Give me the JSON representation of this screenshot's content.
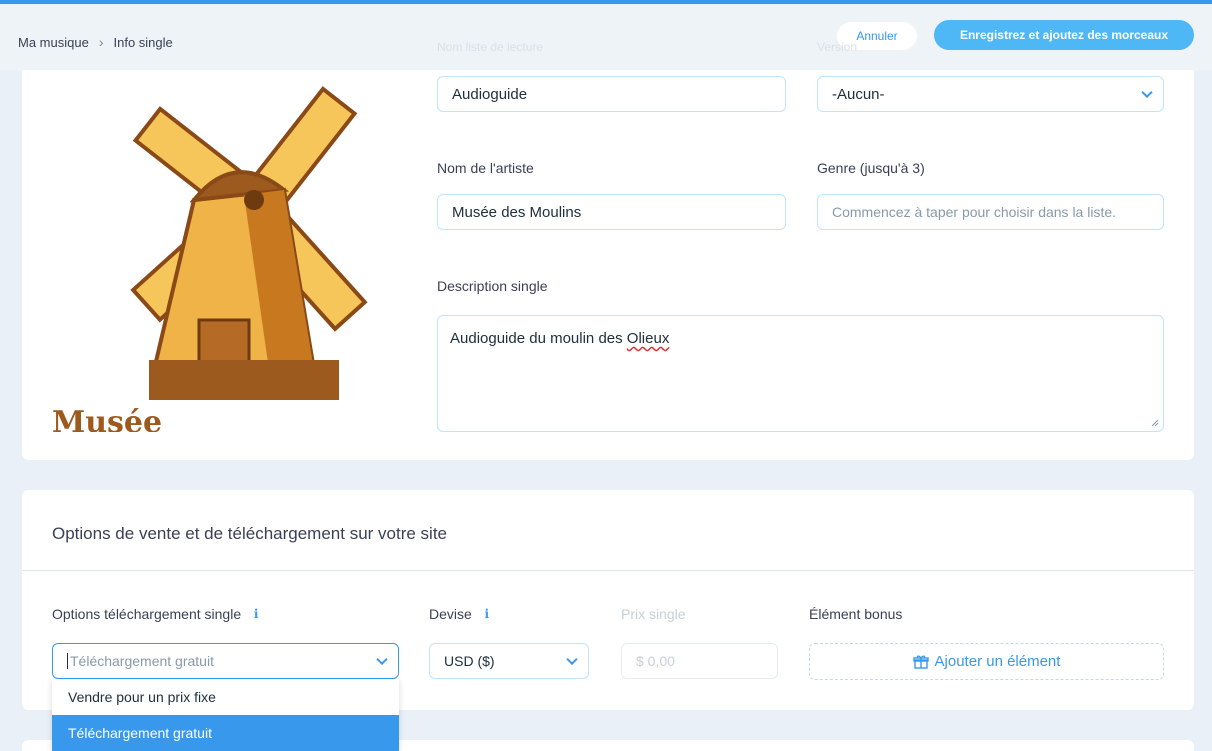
{
  "header": {
    "breadcrumb": [
      "Ma musique",
      "Info single"
    ],
    "cancel_label": "Annuler",
    "save_label": "Enregistrez et ajoutez des morceaux"
  },
  "form": {
    "playlist_name_label": "Nom liste de lecture",
    "playlist_name_value": "Audioguide",
    "version_label": "Version",
    "version_value": "-Aucun-",
    "artist_label": "Nom de l'artiste",
    "artist_value": "Musée des Moulins",
    "genre_label": "Genre (jusqu'à 3)",
    "genre_placeholder": "Commencez à taper pour choisir dans la liste.",
    "description_label": "Description single",
    "description_value_prefix": "Audioguide du moulin des ",
    "description_value_misspelled": "Olieux",
    "cover_caption": "Musée"
  },
  "sales": {
    "title": "Options de vente et de téléchargement sur votre site",
    "download_options_label": "Options téléchargement single",
    "download_options_value": "Téléchargement gratuit",
    "currency_label": "Devise",
    "currency_value": "USD ($)",
    "price_label": "Prix single",
    "price_value": "$ 0,00",
    "bonus_label": "Élément bonus",
    "bonus_button": "Ajouter un élément",
    "dropdown_options": [
      "Vendre pour un prix fixe",
      "Téléchargement gratuit"
    ],
    "dropdown_selected": "Téléchargement gratuit"
  },
  "colors": {
    "accent": "#3899ec",
    "save_button": "#4eb7f5",
    "background": "#e9f0f7"
  }
}
